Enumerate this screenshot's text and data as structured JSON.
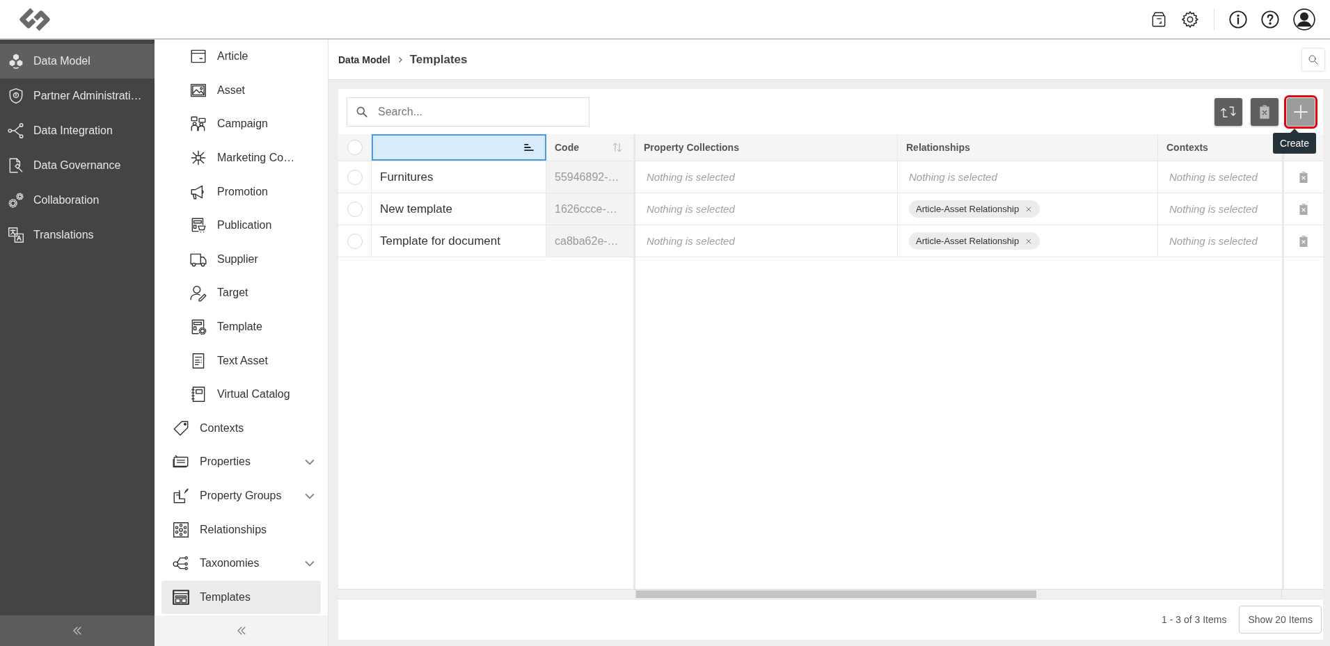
{
  "main_nav": {
    "items": [
      {
        "label": "Data Model",
        "selected": true
      },
      {
        "label": "Partner Administrati…",
        "selected": false
      },
      {
        "label": "Data Integration",
        "selected": false
      },
      {
        "label": "Data Governance",
        "selected": false
      },
      {
        "label": "Collaboration",
        "selected": false
      },
      {
        "label": "Translations",
        "selected": false
      }
    ]
  },
  "sub_nav": {
    "items": [
      {
        "label": "Article",
        "kind": "child",
        "selected": false,
        "expandable": false
      },
      {
        "label": "Asset",
        "kind": "child",
        "selected": false,
        "expandable": false
      },
      {
        "label": "Campaign",
        "kind": "child",
        "selected": false,
        "expandable": false
      },
      {
        "label": "Marketing Co…",
        "kind": "child",
        "selected": false,
        "expandable": false
      },
      {
        "label": "Promotion",
        "kind": "child",
        "selected": false,
        "expandable": false
      },
      {
        "label": "Publication",
        "kind": "child",
        "selected": false,
        "expandable": false
      },
      {
        "label": "Supplier",
        "kind": "child",
        "selected": false,
        "expandable": false
      },
      {
        "label": "Target",
        "kind": "child",
        "selected": false,
        "expandable": false
      },
      {
        "label": "Template",
        "kind": "child",
        "selected": false,
        "expandable": false
      },
      {
        "label": "Text Asset",
        "kind": "child",
        "selected": false,
        "expandable": false
      },
      {
        "label": "Virtual Catalog",
        "kind": "child",
        "selected": false,
        "expandable": false
      },
      {
        "label": "Contexts",
        "kind": "top",
        "selected": false,
        "expandable": false
      },
      {
        "label": "Properties",
        "kind": "top",
        "selected": false,
        "expandable": true
      },
      {
        "label": "Property Groups",
        "kind": "top",
        "selected": false,
        "expandable": true
      },
      {
        "label": "Relationships",
        "kind": "top",
        "selected": false,
        "expandable": false
      },
      {
        "label": "Taxonomies",
        "kind": "top",
        "selected": false,
        "expandable": true
      },
      {
        "label": "Templates",
        "kind": "top",
        "selected": true,
        "expandable": false
      }
    ]
  },
  "breadcrumb": [
    {
      "label": "Data Model"
    },
    {
      "label": "Templates"
    }
  ],
  "search": {
    "placeholder": "Search..."
  },
  "toolbar": {
    "buttons": [
      {
        "kind": "sync",
        "highlighted": false
      },
      {
        "kind": "delete",
        "highlighted": false
      },
      {
        "kind": "create",
        "highlighted": true,
        "tooltip": "Create"
      }
    ]
  },
  "table": {
    "select_all": {
      "selected": false
    },
    "columns": [
      {
        "selected": true,
        "sorted": true
      },
      {
        "label": "Code",
        "selected": false,
        "sorted": false
      },
      {
        "label": "Property Collections",
        "selected": false
      },
      {
        "label": "Relationships",
        "selected": false
      },
      {
        "label": "Contexts",
        "selected": false
      }
    ],
    "rows": [
      {
        "selected": false,
        "cells": [
          {
            "kind": "name",
            "text": "Furnitures"
          },
          {
            "kind": "code",
            "text": "55946892-…"
          },
          {
            "kind": "empty",
            "text": "Nothing is selected"
          },
          {
            "kind": "empty",
            "text": "Nothing is selected"
          },
          {
            "kind": "empty",
            "text": "Nothing is selected"
          }
        ]
      },
      {
        "selected": false,
        "cells": [
          {
            "kind": "name",
            "text": "New template"
          },
          {
            "kind": "code",
            "text": "1626ccce-…"
          },
          {
            "kind": "empty",
            "text": "Nothing is selected"
          },
          {
            "kind": "tags",
            "tags": [
              "Article-Asset Relationship"
            ]
          },
          {
            "kind": "empty",
            "text": "Nothing is selected"
          }
        ]
      },
      {
        "selected": false,
        "cells": [
          {
            "kind": "name",
            "text": "Template for document"
          },
          {
            "kind": "code",
            "text": "ca8ba62e-…"
          },
          {
            "kind": "empty",
            "text": "Nothing is selected"
          },
          {
            "kind": "tags",
            "tags": [
              "Article-Asset Relationship"
            ]
          },
          {
            "kind": "empty",
            "text": "Nothing is selected"
          }
        ]
      }
    ]
  },
  "footer": {
    "range": "1 - 3 of 3 Items",
    "page_size_button": "Show 20 Items"
  }
}
